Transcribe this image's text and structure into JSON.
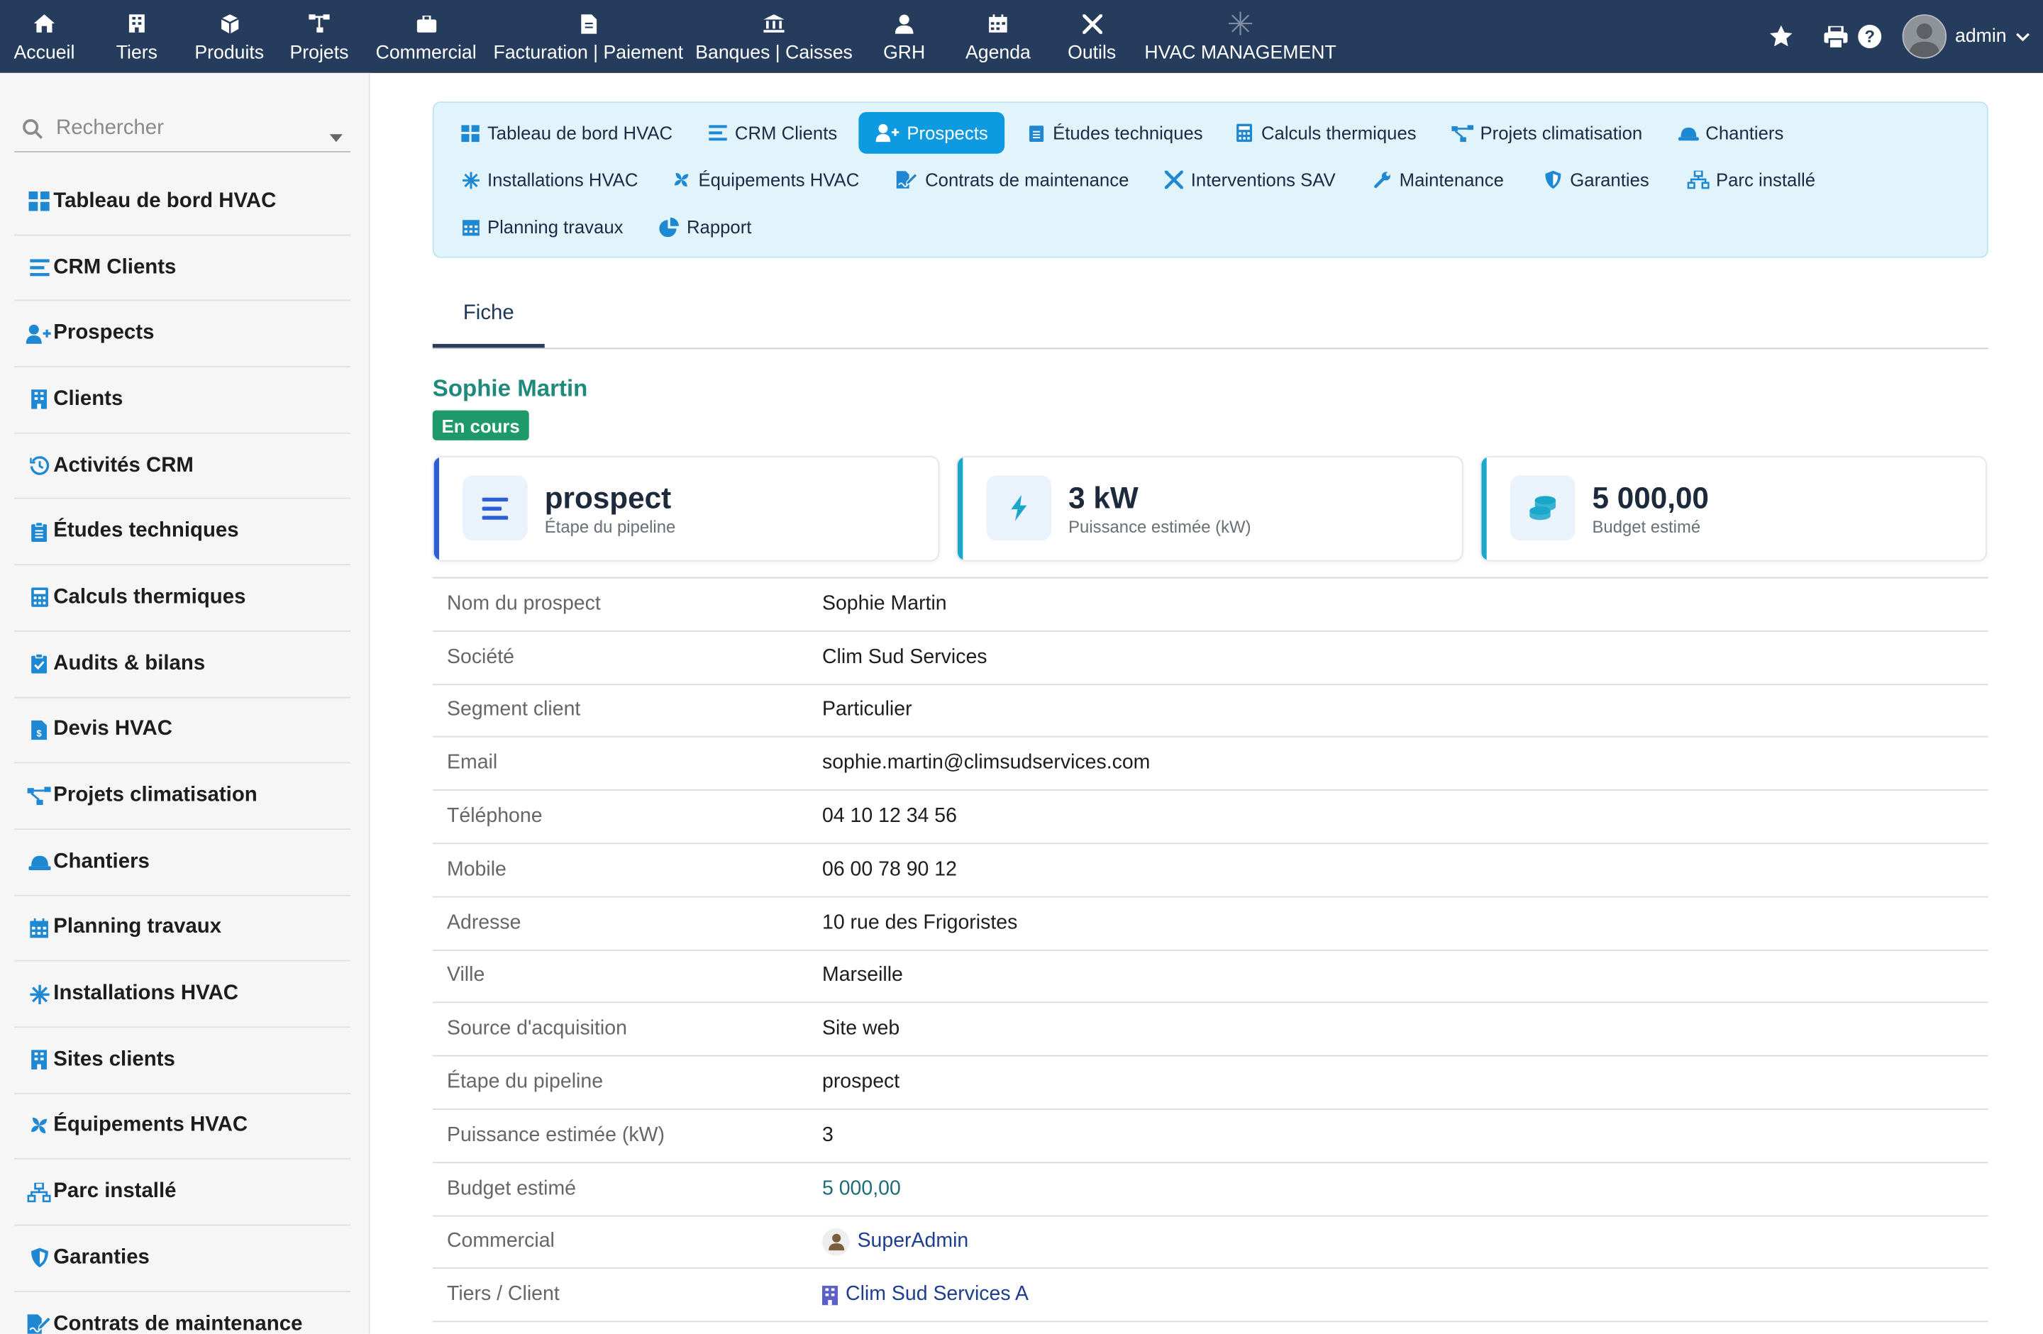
{
  "topnav": {
    "items": [
      {
        "label": "Accueil",
        "icon": "home-icon"
      },
      {
        "label": "Tiers",
        "icon": "building-icon"
      },
      {
        "label": "Produits",
        "icon": "cube-icon"
      },
      {
        "label": "Projets",
        "icon": "sitemap-icon"
      },
      {
        "label": "Commercial",
        "icon": "briefcase-icon"
      },
      {
        "label": "Facturation | Paiement",
        "icon": "invoice-icon"
      },
      {
        "label": "Banques | Caisses",
        "icon": "bank-icon"
      },
      {
        "label": "GRH",
        "icon": "user-tie-icon"
      },
      {
        "label": "Agenda",
        "icon": "calendar-icon"
      },
      {
        "label": "Outils",
        "icon": "tools-icon"
      },
      {
        "label": "HVAC MANAGEMENT",
        "icon": "snowflake-icon"
      }
    ],
    "user": "admin"
  },
  "sidebar": {
    "search_placeholder": "Rechercher",
    "items": [
      {
        "label": "Tableau de bord HVAC",
        "icon": "dashboard-grid-icon"
      },
      {
        "label": "CRM Clients",
        "icon": "list-icon"
      },
      {
        "label": "Prospects",
        "icon": "user-plus-icon"
      },
      {
        "label": "Clients",
        "icon": "building-icon"
      },
      {
        "label": "Activités CRM",
        "icon": "history-icon"
      },
      {
        "label": "Études techniques",
        "icon": "clipboard-icon"
      },
      {
        "label": "Calculs thermiques",
        "icon": "calculator-icon"
      },
      {
        "label": "Audits & bilans",
        "icon": "clipboard-check-icon"
      },
      {
        "label": "Devis HVAC",
        "icon": "invoice-dollar-icon"
      },
      {
        "label": "Projets climatisation",
        "icon": "project-diagram-icon"
      },
      {
        "label": "Chantiers",
        "icon": "hard-hat-icon"
      },
      {
        "label": "Planning travaux",
        "icon": "calendar-icon"
      },
      {
        "label": "Installations HVAC",
        "icon": "snowflake-icon"
      },
      {
        "label": "Sites clients",
        "icon": "building-icon"
      },
      {
        "label": "Équipements HVAC",
        "icon": "fan-icon"
      },
      {
        "label": "Parc installé",
        "icon": "network-icon"
      },
      {
        "label": "Garanties",
        "icon": "shield-icon"
      },
      {
        "label": "Contrats de maintenance",
        "icon": "file-signature-icon"
      }
    ]
  },
  "hvac_menu": [
    {
      "label": "Tableau de bord HVAC",
      "icon": "dashboard-grid-icon",
      "active": false
    },
    {
      "label": "CRM Clients",
      "icon": "list-icon",
      "active": false
    },
    {
      "label": "Prospects",
      "icon": "user-plus-icon",
      "active": true
    },
    {
      "label": "Études techniques",
      "icon": "clipboard-icon",
      "active": false
    },
    {
      "label": "Calculs thermiques",
      "icon": "calculator-icon",
      "active": false
    },
    {
      "label": "Projets climatisation",
      "icon": "project-diagram-icon",
      "active": false
    },
    {
      "label": "Chantiers",
      "icon": "hard-hat-icon",
      "active": false
    },
    {
      "label": "Installations HVAC",
      "icon": "snowflake-icon",
      "active": false
    },
    {
      "label": "Équipements HVAC",
      "icon": "fan-icon",
      "active": false
    },
    {
      "label": "Contrats de maintenance",
      "icon": "file-signature-icon",
      "active": false
    },
    {
      "label": "Interventions SAV",
      "icon": "tools-icon",
      "active": false
    },
    {
      "label": "Maintenance",
      "icon": "wrench-icon",
      "active": false
    },
    {
      "label": "Garanties",
      "icon": "shield-icon",
      "active": false
    },
    {
      "label": "Parc installé",
      "icon": "network-icon",
      "active": false
    },
    {
      "label": "Planning travaux",
      "icon": "calendar-icon",
      "active": false
    },
    {
      "label": "Rapport",
      "icon": "pie-chart-icon",
      "active": false
    }
  ],
  "tabs": [
    {
      "label": "Fiche",
      "active": true
    }
  ],
  "record": {
    "name": "Sophie Martin",
    "status": "En cours"
  },
  "cards": [
    {
      "value": "prospect",
      "label": "Étape du pipeline",
      "icon": "list-icon",
      "accent": "#2c5fd6"
    },
    {
      "value": "3 kW",
      "label": "Puissance estimée (kW)",
      "icon": "bolt-icon",
      "accent": "#1aa7c9"
    },
    {
      "value": "5 000,00",
      "label": "Budget estimé",
      "icon": "coins-icon",
      "accent": "#1aa7c9"
    }
  ],
  "details": [
    {
      "label": "Nom du prospect",
      "value": "Sophie Martin"
    },
    {
      "label": "Société",
      "value": "Clim Sud Services"
    },
    {
      "label": "Segment client",
      "value": "Particulier"
    },
    {
      "label": "Email",
      "value": "sophie.martin@climsudservices.com"
    },
    {
      "label": "Téléphone",
      "value": "04 10 12 34 56"
    },
    {
      "label": "Mobile",
      "value": "06 00 78 90 12"
    },
    {
      "label": "Adresse",
      "value": "10 rue des Frigoristes"
    },
    {
      "label": "Ville",
      "value": "Marseille"
    },
    {
      "label": "Source d'acquisition",
      "value": "Site web"
    },
    {
      "label": "Étape du pipeline",
      "value": "prospect"
    },
    {
      "label": "Puissance estimée (kW)",
      "value": "3"
    },
    {
      "label": "Budget estimé",
      "value": "5 000,00"
    },
    {
      "label": "Commercial",
      "value": "SuperAdmin",
      "icon": "user-avatar-icon"
    },
    {
      "label": "Tiers / Client",
      "value": "Clim Sud Services A",
      "icon": "building-icon"
    }
  ],
  "colors": {
    "topbar": "#263c5c",
    "accent_active": "#0d9ae1",
    "title": "#1f8a7c",
    "badge": "#1e9a6a"
  }
}
